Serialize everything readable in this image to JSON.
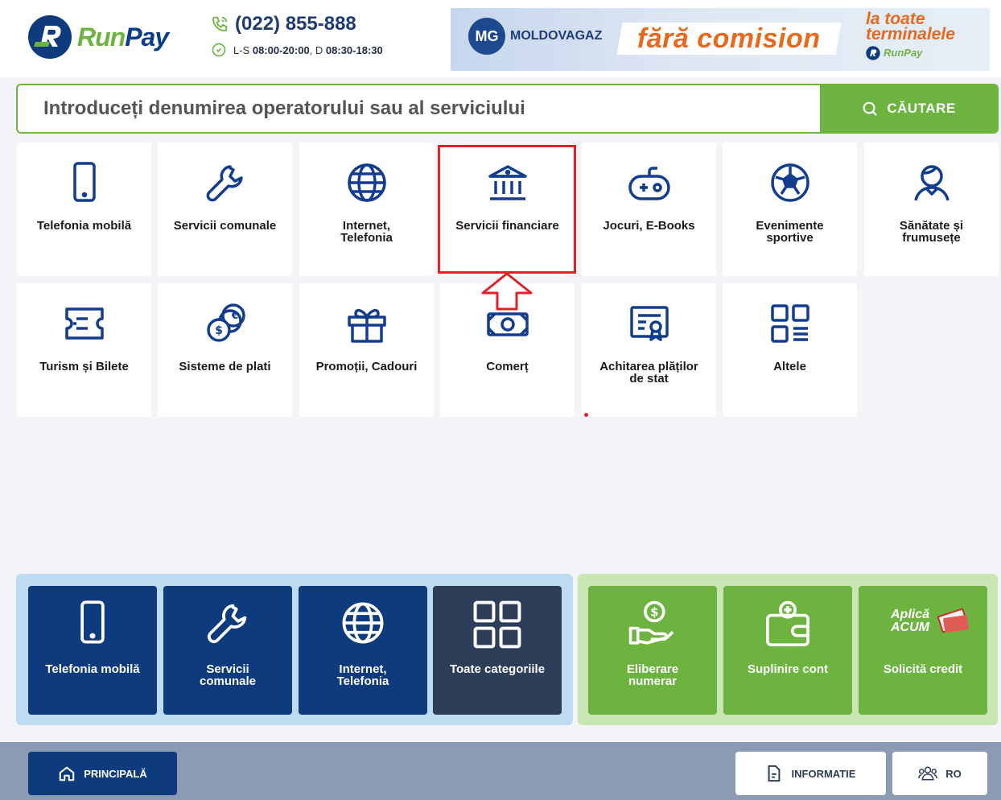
{
  "header": {
    "logo_text_a": "Run",
    "logo_text_b": "Pay",
    "phone": "(022) 855-888",
    "hours_prefix": "L-S ",
    "hours_weekday": "08:00-20:00",
    "hours_mid": ", D ",
    "hours_sunday": "08:30-18:30"
  },
  "banner": {
    "brand": "MOLDOVAGAZ",
    "promo": "fără comision",
    "right_line1": "la toate",
    "right_line2": "terminalele",
    "right_brand": "RunPay"
  },
  "search": {
    "placeholder": "Introduceți denumirea operatorului sau al serviciului",
    "button_label": "CĂUTARE"
  },
  "categories": [
    {
      "label": "Telefonia mobilă",
      "icon": "phone-icon"
    },
    {
      "label": "Servicii comunale",
      "icon": "wrench-icon"
    },
    {
      "label": "Internet,\nTelefonia",
      "icon": "globe-icon"
    },
    {
      "label": "Servicii financiare",
      "icon": "bank-icon"
    },
    {
      "label": "Jocuri, E-Books",
      "icon": "gamepad-icon"
    },
    {
      "label": "Evenimente\nsportive",
      "icon": "soccer-ball-icon"
    },
    {
      "label": "Sănătate și\nfrumusețe",
      "icon": "person-icon"
    },
    {
      "label": "Turism și Bilete",
      "icon": "ticket-icon"
    },
    {
      "label": "Sisteme de plati",
      "icon": "coins-icon"
    },
    {
      "label": "Promoții, Cadouri",
      "icon": "gift-icon"
    },
    {
      "label": "Comerț",
      "icon": "banknote-icon"
    },
    {
      "label": "Achitarea plăților\nde stat",
      "icon": "certificate-icon"
    },
    {
      "label": "Altele",
      "icon": "grid-icon"
    }
  ],
  "quick_blue": [
    {
      "label": "Telefonia mobilă",
      "icon": "phone-icon"
    },
    {
      "label": "Servicii\ncomunale",
      "icon": "wrench-icon"
    },
    {
      "label": "Internet,\nTelefonia",
      "icon": "globe-icon"
    },
    {
      "label": "Toate categoriile",
      "icon": "grid-icon"
    }
  ],
  "quick_green": [
    {
      "label": "Eliberare\nnumerar",
      "icon": "cash-hand-icon"
    },
    {
      "label": "Suplinire cont",
      "icon": "wallet-icon"
    },
    {
      "label": "Solicită credit",
      "icon": "apply-now-icon",
      "badge_line1": "Aplică",
      "badge_line2": "ACUM"
    }
  ],
  "footer": {
    "main_label": "PRINCIPALĂ",
    "info_label": "INFORMATIE",
    "lang_label": "RO"
  },
  "colors": {
    "brand_blue": "#0e3a7e",
    "brand_green": "#6db33f",
    "highlight_red": "#e3202a",
    "icon_blue": "#123d8f"
  }
}
